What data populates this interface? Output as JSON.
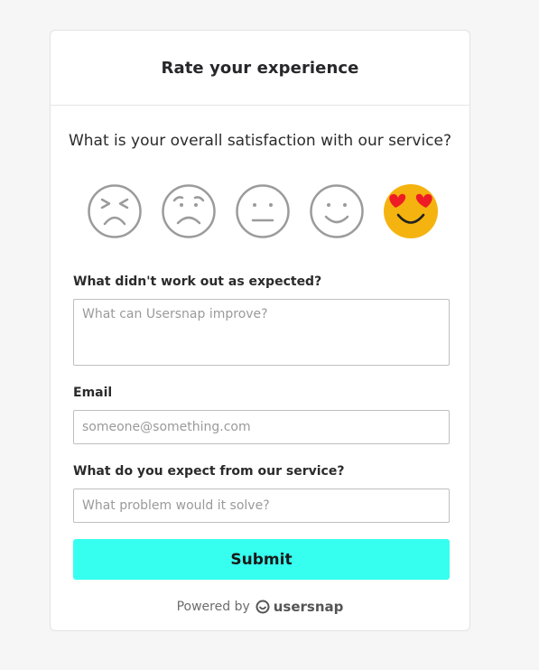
{
  "form": {
    "title": "Rate your experience",
    "question": "What is your overall satisfaction with our service?",
    "ratings": [
      {
        "label": "very-dissatisfied",
        "selected": false
      },
      {
        "label": "dissatisfied",
        "selected": false
      },
      {
        "label": "neutral",
        "selected": false
      },
      {
        "label": "satisfied",
        "selected": false
      },
      {
        "label": "very-satisfied",
        "selected": true
      }
    ],
    "improve_label": "What didn't work out as expected?",
    "improve_placeholder": "What can Usersnap improve?",
    "email_label": "Email",
    "email_placeholder": "someone@something.com",
    "expect_label": "What do you expect from our service?",
    "expect_placeholder": "What problem would it solve?",
    "submit_label": "Submit"
  },
  "footer": {
    "powered_by": "Powered by",
    "brand": "usersnap"
  },
  "colors": {
    "accent": "#36fff0",
    "selected_face": "#f5b30f",
    "heart": "#ee1c25",
    "face_outline": "#9b9b9b"
  }
}
